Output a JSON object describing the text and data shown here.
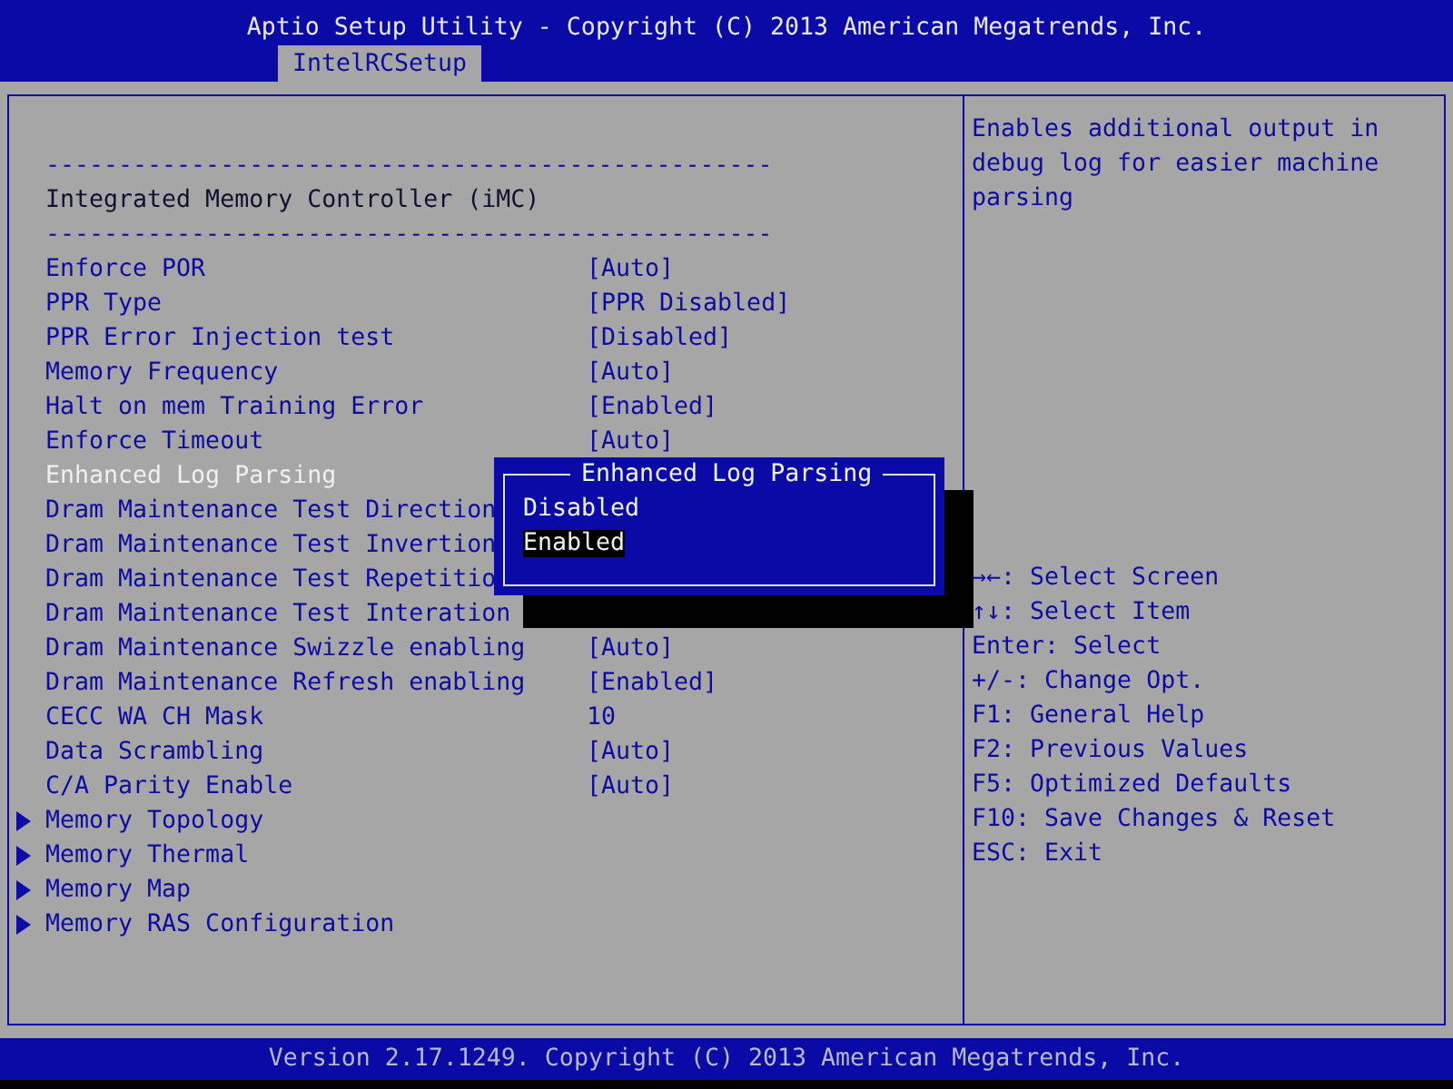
{
  "header": {
    "title": "Aptio Setup Utility - Copyright (C) 2013 American Megatrends, Inc.",
    "tabs": [
      {
        "label": "IntelRCSetup",
        "selected": true
      }
    ]
  },
  "items": [
    {
      "kind": "divider",
      "text": "--------------------------------------------------"
    },
    {
      "kind": "heading",
      "text": "Integrated Memory Controller (iMC)"
    },
    {
      "kind": "divider",
      "text": "--------------------------------------------------"
    },
    {
      "kind": "setting",
      "label": "Enforce POR",
      "value": "[Auto]",
      "selected": false
    },
    {
      "kind": "setting",
      "label": "PPR Type",
      "value": "[PPR Disabled]",
      "selected": false
    },
    {
      "kind": "setting",
      "label": "PPR Error Injection test",
      "value": "[Disabled]",
      "selected": false
    },
    {
      "kind": "setting",
      "label": "Memory Frequency",
      "value": "[Auto]",
      "selected": false
    },
    {
      "kind": "setting",
      "label": "Halt on mem Training Error",
      "value": "[Enabled]",
      "selected": false
    },
    {
      "kind": "setting",
      "label": "Enforce Timeout",
      "value": "[Auto]",
      "selected": false
    },
    {
      "kind": "setting",
      "label": "Enhanced Log Parsing",
      "selected": true
    },
    {
      "kind": "setting",
      "label": "Dram Maintenance Test Direction",
      "selected": false
    },
    {
      "kind": "setting",
      "label": "Dram Maintenance Test Invertion",
      "selected": false
    },
    {
      "kind": "setting",
      "label": "Dram Maintenance Test Repetitio",
      "selected": false
    },
    {
      "kind": "setting",
      "label": "Dram Maintenance Test Interation",
      "selected": false
    },
    {
      "kind": "setting",
      "label": "Dram Maintenance Swizzle enabling",
      "value": "[Auto]",
      "selected": false
    },
    {
      "kind": "setting",
      "label": "Dram Maintenance Refresh enabling",
      "value": "[Enabled]",
      "selected": false
    },
    {
      "kind": "setting",
      "label": "CECC WA CH Mask",
      "value": "10",
      "selected": false
    },
    {
      "kind": "setting",
      "label": "Data Scrambling",
      "value": "[Auto]",
      "selected": false
    },
    {
      "kind": "setting",
      "label": "C/A Parity Enable",
      "value": "[Auto]",
      "selected": false
    },
    {
      "kind": "submenu",
      "label": "Memory Topology",
      "selected": false
    },
    {
      "kind": "submenu",
      "label": "Memory Thermal",
      "selected": false
    },
    {
      "kind": "submenu",
      "label": "Memory Map",
      "selected": false
    },
    {
      "kind": "submenu",
      "label": "Memory RAS Configuration",
      "selected": false
    }
  ],
  "popup": {
    "title": "Enhanced Log Parsing",
    "options": [
      {
        "label": "Disabled",
        "selected": false
      },
      {
        "label": "Enabled",
        "selected": true
      }
    ]
  },
  "help": {
    "description": "Enables additional output in debug log for easier machine parsing",
    "keys": [
      "→←: Select Screen",
      "↑↓: Select Item",
      "Enter: Select",
      "+/-: Change Opt.",
      "F1: General Help",
      "F2: Previous Values",
      "F5: Optimized Defaults",
      "F10: Save Changes & Reset",
      "ESC: Exit"
    ]
  },
  "footer": "Version 2.17.1249. Copyright (C) 2013 American Megatrends, Inc."
}
